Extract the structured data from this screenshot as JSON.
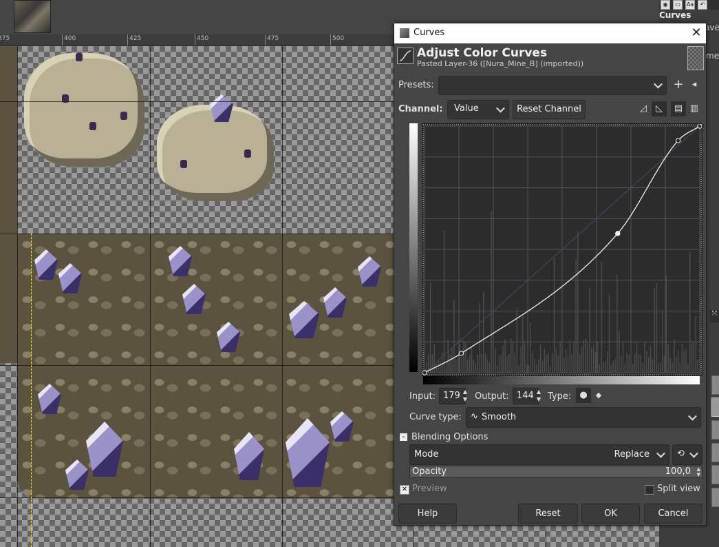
{
  "ruler": {
    "ticks": [
      "375",
      "400",
      "425",
      "450",
      "475",
      "500"
    ]
  },
  "dock": {
    "label": "Curves",
    "partial_text": "ave",
    "partial_text2": "men"
  },
  "dialog": {
    "window_title": "Curves",
    "close_glyph": "✕",
    "header_title": "Adjust Color Curves",
    "header_subtitle": "Pasted Layer-36 ([Nura_Mine_B] (imported))",
    "presets_label": "Presets:",
    "presets_value": "",
    "channel_label": "Channel:",
    "channel_value": "Value",
    "reset_channel_label": "Reset Channel",
    "input_label": "Input:",
    "input_value": "179",
    "output_label": "Output:",
    "output_value": "144",
    "type_label": "Type:",
    "curve_type_label": "Curve type:",
    "curve_type_value": "Smooth",
    "blending_label": "Blending Options",
    "mode_label": "Mode",
    "mode_value": "Replace",
    "opacity_label": "Opacity",
    "opacity_value": "100,0",
    "opacity_level": 1.0,
    "preview_label": "Preview",
    "split_view_label": "Split view",
    "help_label": "Help",
    "reset_label": "Reset",
    "ok_label": "OK",
    "cancel_label": "Cancel"
  },
  "curve": {
    "control_points": [
      [
        0,
        0
      ],
      [
        34,
        20
      ],
      [
        179,
        144
      ],
      [
        235,
        240
      ],
      [
        255,
        255
      ]
    ],
    "selected_point": [
      179,
      144
    ]
  },
  "colors": {
    "accent": "#ffffff",
    "dialog_bg": "#454545",
    "graph_bg": "#2c2c2c"
  }
}
